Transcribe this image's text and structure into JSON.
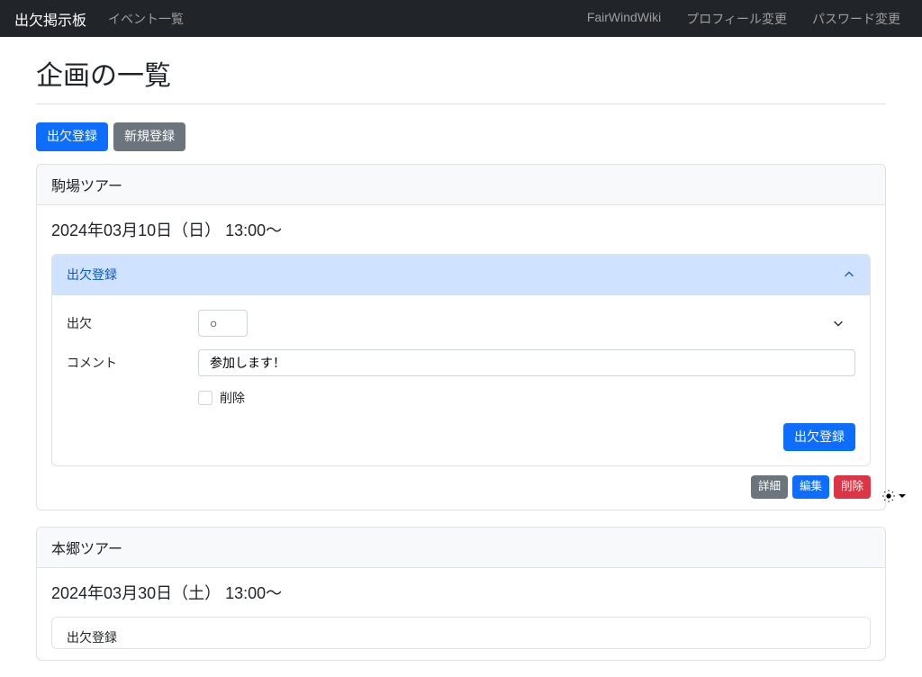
{
  "nav": {
    "brand": "出欠掲示板",
    "link_events": "イベント一覧",
    "link_wiki": "FairWindWiki",
    "link_profile": "プロフィール変更",
    "link_password": "パスワード変更"
  },
  "page": {
    "title": "企画の一覧"
  },
  "buttons": {
    "attendance_register": "出欠登録",
    "new_register": "新規登録",
    "detail": "詳細",
    "edit": "編集",
    "delete": "削除"
  },
  "events": [
    {
      "title": "駒場ツアー",
      "datetime": "2024年03月10日（日） 13:00〜",
      "accordion_label": "出欠登録",
      "form": {
        "attendance_label": "出欠",
        "attendance_value": "○",
        "comment_label": "コメント",
        "comment_value": "参加します！",
        "delete_checkbox": "削除",
        "submit": "出欠登録"
      }
    },
    {
      "title": "本郷ツアー",
      "datetime": "2024年03月30日（土） 13:00〜",
      "accordion_label": "出欠登録"
    }
  ]
}
